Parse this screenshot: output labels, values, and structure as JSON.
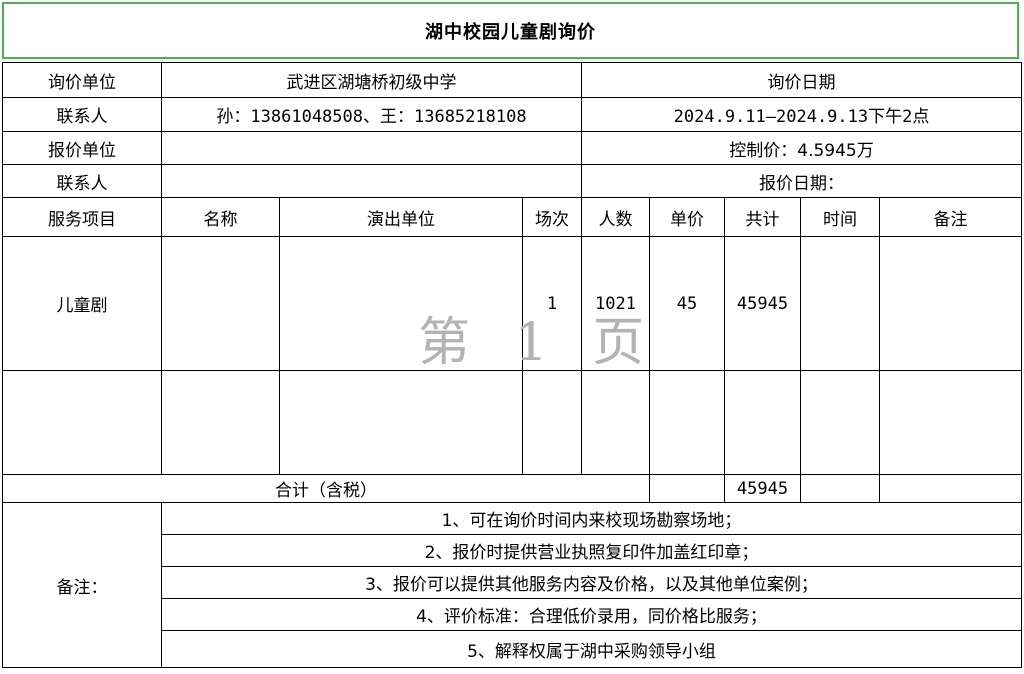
{
  "title": "湖中校园儿童剧询价",
  "header": {
    "inquiry_unit_label": "询价单位",
    "inquiry_unit_value": "武进区湖塘桥初级中学",
    "inquiry_date_label": "询价日期",
    "contact_label": "联系人",
    "contact_value": "孙：13861048508、王：13685218108",
    "inquiry_date_value": "2024.9.11—2024.9.13下午2点",
    "quote_unit_label": "报价单位",
    "control_price": "控制价：4.5945万",
    "contact2_label": "联系人",
    "quote_date": "报价日期："
  },
  "columns": [
    "服务项目",
    "名称",
    "演出单位",
    "场次",
    "人数",
    "单价",
    "共计",
    "时间",
    "备注"
  ],
  "rows": [
    {
      "service": "儿童剧",
      "name": "",
      "performer": "",
      "sessions": "1",
      "people": "1021",
      "unit_price": "45",
      "total": "45945",
      "time": "",
      "remark": ""
    },
    {
      "service": "",
      "name": "",
      "performer": "",
      "sessions": "",
      "people": "",
      "unit_price": "",
      "total": "",
      "time": "",
      "remark": ""
    }
  ],
  "total_row": {
    "label": "合计（含税）",
    "total": "45945"
  },
  "notes": {
    "label": "备注：",
    "items": [
      "1、可在询价时间内来校现场勘察场地；",
      "2、报价时提供营业执照复印件加盖红印章；",
      "3、报价可以提供其他服务内容及价格，以及其他单位案例；",
      "4、评价标准：合理低价录用，同价格比服务；",
      "5、解释权属于湖中采购领导小组"
    ]
  },
  "watermark": "第 1 页",
  "colors": {
    "title_border": "#4caf50",
    "watermark": "#b3b3b3"
  }
}
